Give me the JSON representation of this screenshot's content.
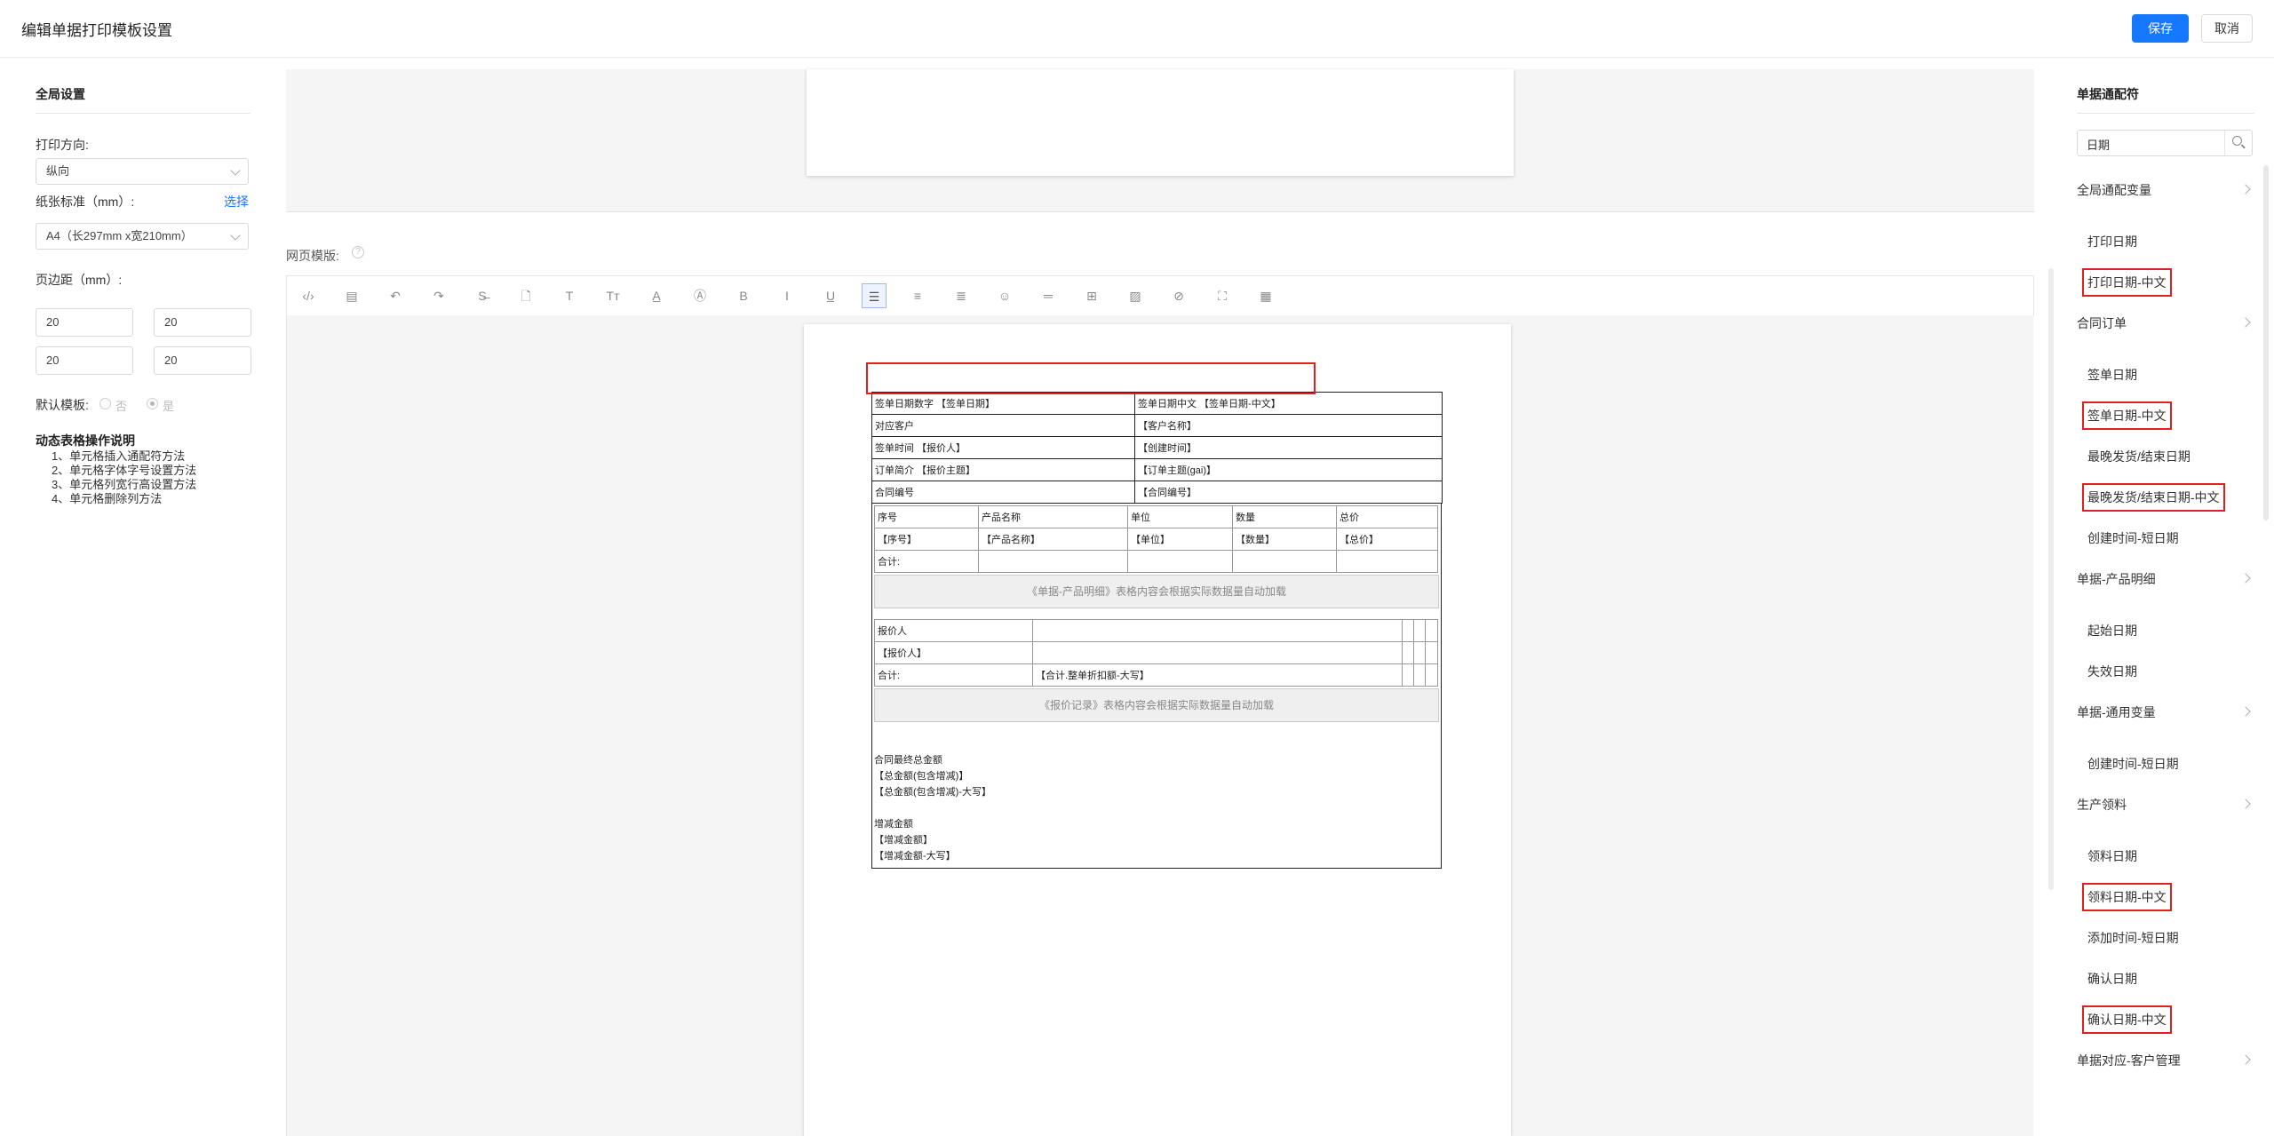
{
  "header": {
    "title": "编辑单据打印模板设置",
    "save_label": "保存",
    "cancel_label": "取消"
  },
  "left": {
    "section_title": "全局设置",
    "orientation_label": "打印方向:",
    "orientation_value": "纵向",
    "paper_label": "纸张标准（mm）:",
    "paper_select_link": "选择",
    "paper_value": "A4（长297mm x宽210mm）",
    "margin_label": "页边距（mm）:",
    "margins": [
      "20",
      "20",
      "20",
      "20"
    ],
    "default_label": "默认模板:",
    "default_no": "否",
    "default_yes": "是",
    "help_title": "动态表格操作说明",
    "help_items": [
      "1、单元格插入通配符方法",
      "2、单元格字体字号设置方法",
      "3、单元格列宽行高设置方法",
      "4、单元格删除列方法"
    ]
  },
  "center": {
    "web_template_label": "网页模版:",
    "help_icon": "?",
    "toolbar": [
      {
        "name": "source-code-icon",
        "glyph": "‹/›"
      },
      {
        "name": "template-icon",
        "glyph": "▤"
      },
      {
        "name": "undo-icon",
        "glyph": "↶"
      },
      {
        "name": "redo-icon",
        "glyph": "↷"
      },
      {
        "name": "strikethrough-icon",
        "glyph": "S̶"
      },
      {
        "name": "document-icon",
        "glyph": "🗋"
      },
      {
        "name": "text-icon",
        "glyph": "T"
      },
      {
        "name": "font-size-icon",
        "glyph": "Tт"
      },
      {
        "name": "font-color-icon",
        "glyph": "A̲"
      },
      {
        "name": "background-color-icon",
        "glyph": "Ⓐ"
      },
      {
        "name": "bold-icon",
        "glyph": "B"
      },
      {
        "name": "italic-icon",
        "glyph": "I"
      },
      {
        "name": "underline-icon",
        "glyph": "U̲"
      },
      {
        "name": "align-left-icon",
        "glyph": "☰"
      },
      {
        "name": "align-center-icon",
        "glyph": "≡"
      },
      {
        "name": "align-right-icon",
        "glyph": "≣"
      },
      {
        "name": "emoji-icon",
        "glyph": "☺"
      },
      {
        "name": "horizontal-rule-icon",
        "glyph": "═"
      },
      {
        "name": "table-icon",
        "glyph": "⊞"
      },
      {
        "name": "image-icon",
        "glyph": "▨"
      },
      {
        "name": "attachment-icon",
        "glyph": "⊘"
      },
      {
        "name": "fullscreen-icon",
        "glyph": "⛶"
      },
      {
        "name": "dynamic-table-icon",
        "glyph": "▦"
      }
    ],
    "doc": {
      "header_rows": [
        [
          "签单日期数字 【签单日期】",
          "签单日期中文 【签单日期-中文】"
        ],
        [
          "对应客户",
          "【客户名称】"
        ],
        [
          "签单时间 【报价人】",
          "【创建时间】"
        ],
        [
          "订单简介 【报价主题】",
          "【订单主题(gai)】"
        ],
        [
          "合同编号",
          "【合同编号】"
        ]
      ],
      "product_table": {
        "headers": [
          "序号",
          "产品名称",
          "单位",
          "数量",
          "总价"
        ],
        "row": [
          "【序号】",
          "【产品名称】",
          "【单位】",
          "【数量】",
          "【总价】"
        ],
        "total_label": "合计:"
      },
      "product_note": "《单据-产品明细》表格内容会根据实际数据量自动加载",
      "quote_table": {
        "r1": [
          "报价人",
          ""
        ],
        "r2": [
          "【报价人】",
          ""
        ],
        "r3": [
          "合计:",
          "【合计.整单折扣额-大写】"
        ]
      },
      "quote_note": "《报价记录》表格内容会根据实际数据量自动加载",
      "summary_lines": [
        "合同最终总金额",
        "【总金额(包含增减)】",
        "【总金额(包含增减)-大写】",
        "",
        "增减金额",
        "【增减金额】",
        "【增减金额-大写】"
      ]
    }
  },
  "right": {
    "title": "单据通配符",
    "search_value": "日期",
    "groups": [
      {
        "label": "全局通配变量",
        "items": [
          "打印日期",
          "打印日期-中文"
        ]
      },
      {
        "label": "合同订单",
        "items": [
          "签单日期",
          "签单日期-中文",
          "最晚发货/结束日期",
          "最晚发货/结束日期-中文",
          "创建时间-短日期"
        ]
      },
      {
        "label": "单据-产品明细",
        "items": [
          "起始日期",
          "失效日期"
        ]
      },
      {
        "label": "单据-通用变量",
        "items": [
          "创建时间-短日期"
        ]
      },
      {
        "label": "生产领料",
        "items": [
          "领料日期",
          "领料日期-中文",
          "添加时间-短日期",
          "确认日期",
          "确认日期-中文"
        ]
      },
      {
        "label": "单据对应-客户管理",
        "items": []
      }
    ]
  }
}
